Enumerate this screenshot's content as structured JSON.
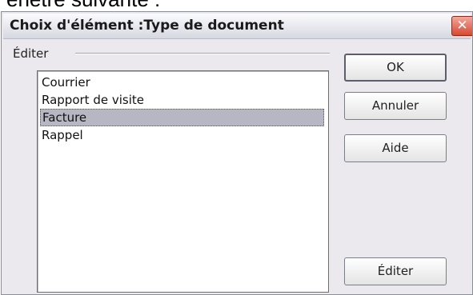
{
  "background_text": "enêtre suivante :",
  "dialog": {
    "title": "Choix d'élément :Type de document",
    "close_glyph": "✕"
  },
  "group": {
    "label": "Éditer"
  },
  "list": {
    "items": [
      "Courrier",
      "Rapport de visite",
      "Facture",
      "Rappel"
    ],
    "selected": "Facture"
  },
  "buttons": {
    "ok": "OK",
    "cancel": "Annuler",
    "help": "Aide",
    "edit": "Éditer"
  },
  "icons": {
    "close": "close-icon"
  },
  "colors": {
    "selection": "#b6b7c3",
    "close_button": "#d9472f"
  }
}
